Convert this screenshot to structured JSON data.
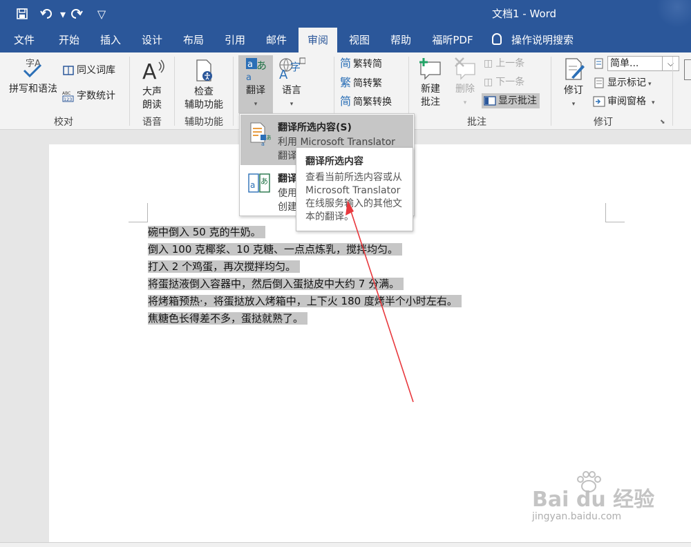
{
  "app": {
    "title": "文档1 - Word",
    "colors": {
      "brand": "#2b579a",
      "selection": "#c6c6c6",
      "annotation": "#e8383d"
    }
  },
  "quick_access": {
    "icons": [
      "save-icon",
      "undo-icon",
      "redo-icon",
      "customize-icon"
    ]
  },
  "tabs": [
    "文件",
    "开始",
    "插入",
    "设计",
    "布局",
    "引用",
    "邮件",
    "审阅",
    "视图",
    "帮助",
    "福昕PDF"
  ],
  "active_tab": "审阅",
  "tell_me": "操作说明搜索",
  "ribbon": {
    "proofing": {
      "label": "校对",
      "spelling": "拼写和语法",
      "thesaurus": "同义词库",
      "word_count": "字数统计"
    },
    "speech": {
      "label": "语音",
      "read_aloud_1": "大声",
      "read_aloud_2": "朗读"
    },
    "accessibility": {
      "label": "辅助功能",
      "check_1": "检查",
      "check_2": "辅助功能"
    },
    "language": {
      "translate": "翻译",
      "language": "语言"
    },
    "chinese": {
      "to_trad": "繁转简",
      "to_simp": "简转繁",
      "convert": "简繁转换"
    },
    "comments": {
      "label": "批注",
      "new_1": "新建",
      "new_2": "批注",
      "delete": "删除",
      "prev": "上一条",
      "next": "下一条",
      "show": "显示批注"
    },
    "tracking": {
      "label": "修订",
      "track": "修订",
      "markup_select": "简单...",
      "show_markup": "显示标记",
      "pane": "审阅窗格"
    }
  },
  "dropdown": {
    "item1_title": "翻译所选内容(S)",
    "item1_desc_1": "利用 Microsoft Translator",
    "item1_desc_2": "翻译",
    "item2_title": "翻译",
    "item2_desc_1": "使用",
    "item2_desc_2": "创建"
  },
  "tooltip": {
    "title": "翻译所选内容",
    "line1": "查看当前所选内容或从",
    "line2": "Microsoft Translator",
    "line3": "在线服务输入的其他文",
    "line4": "本的翻译。"
  },
  "document": {
    "lines": [
      "碗中倒入 50 克的牛奶。",
      "倒入 100 克椰浆、10 克糖、一点点炼乳，搅拌均匀。",
      "打入 2 个鸡蛋，再次搅拌均匀。",
      "将蛋挞液倒入容器中，然后倒入蛋挞皮中大约 7 分满。",
      "将烤箱预热·，将蛋挞放入烤箱中，上下火 180 度烤半个小时左右。",
      "焦糖色长得差不多，蛋挞就熟了。"
    ]
  },
  "watermark": {
    "logo": "Bai du 经验",
    "url": "jingyan.baidu.com"
  }
}
